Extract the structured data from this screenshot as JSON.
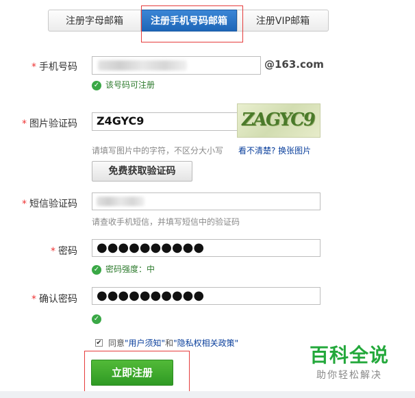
{
  "tabs": [
    {
      "label": "注册字母邮箱"
    },
    {
      "label": "注册手机号码邮箱"
    },
    {
      "label": "注册VIP邮箱"
    }
  ],
  "form": {
    "phone": {
      "label": "手机号码",
      "domain_suffix": "@163.com",
      "status": "该号码可注册"
    },
    "captcha": {
      "label": "图片验证码",
      "value": "Z4GYC9",
      "image_text": "ZAGYC9",
      "hint": "请填写图片中的字符，不区分大小写",
      "refresh_link": "看不清楚? 换张图片",
      "get_sms_button": "免费获取验证码"
    },
    "sms": {
      "label": "短信验证码",
      "hint": "请查收手机短信，并填写短信中的验证码"
    },
    "password": {
      "label": "密码",
      "value": "●●●●●●●●●●",
      "status": "密码强度：中"
    },
    "confirm": {
      "label": "确认密码",
      "value": "●●●●●●●●●●"
    },
    "agree": {
      "prefix": "同意",
      "terms": "\"用户须知\"",
      "conj": "和",
      "privacy": "\"隐私权相关政策\"",
      "checked": true
    },
    "submit": "立即注册"
  },
  "watermark": {
    "title": "百科全说",
    "subtitle": "助你轻松解决"
  },
  "colors": {
    "accent_blue": "#1e66b8",
    "green": "#3aa846",
    "required": "#e33",
    "highlight_box": "#e53b3b"
  }
}
